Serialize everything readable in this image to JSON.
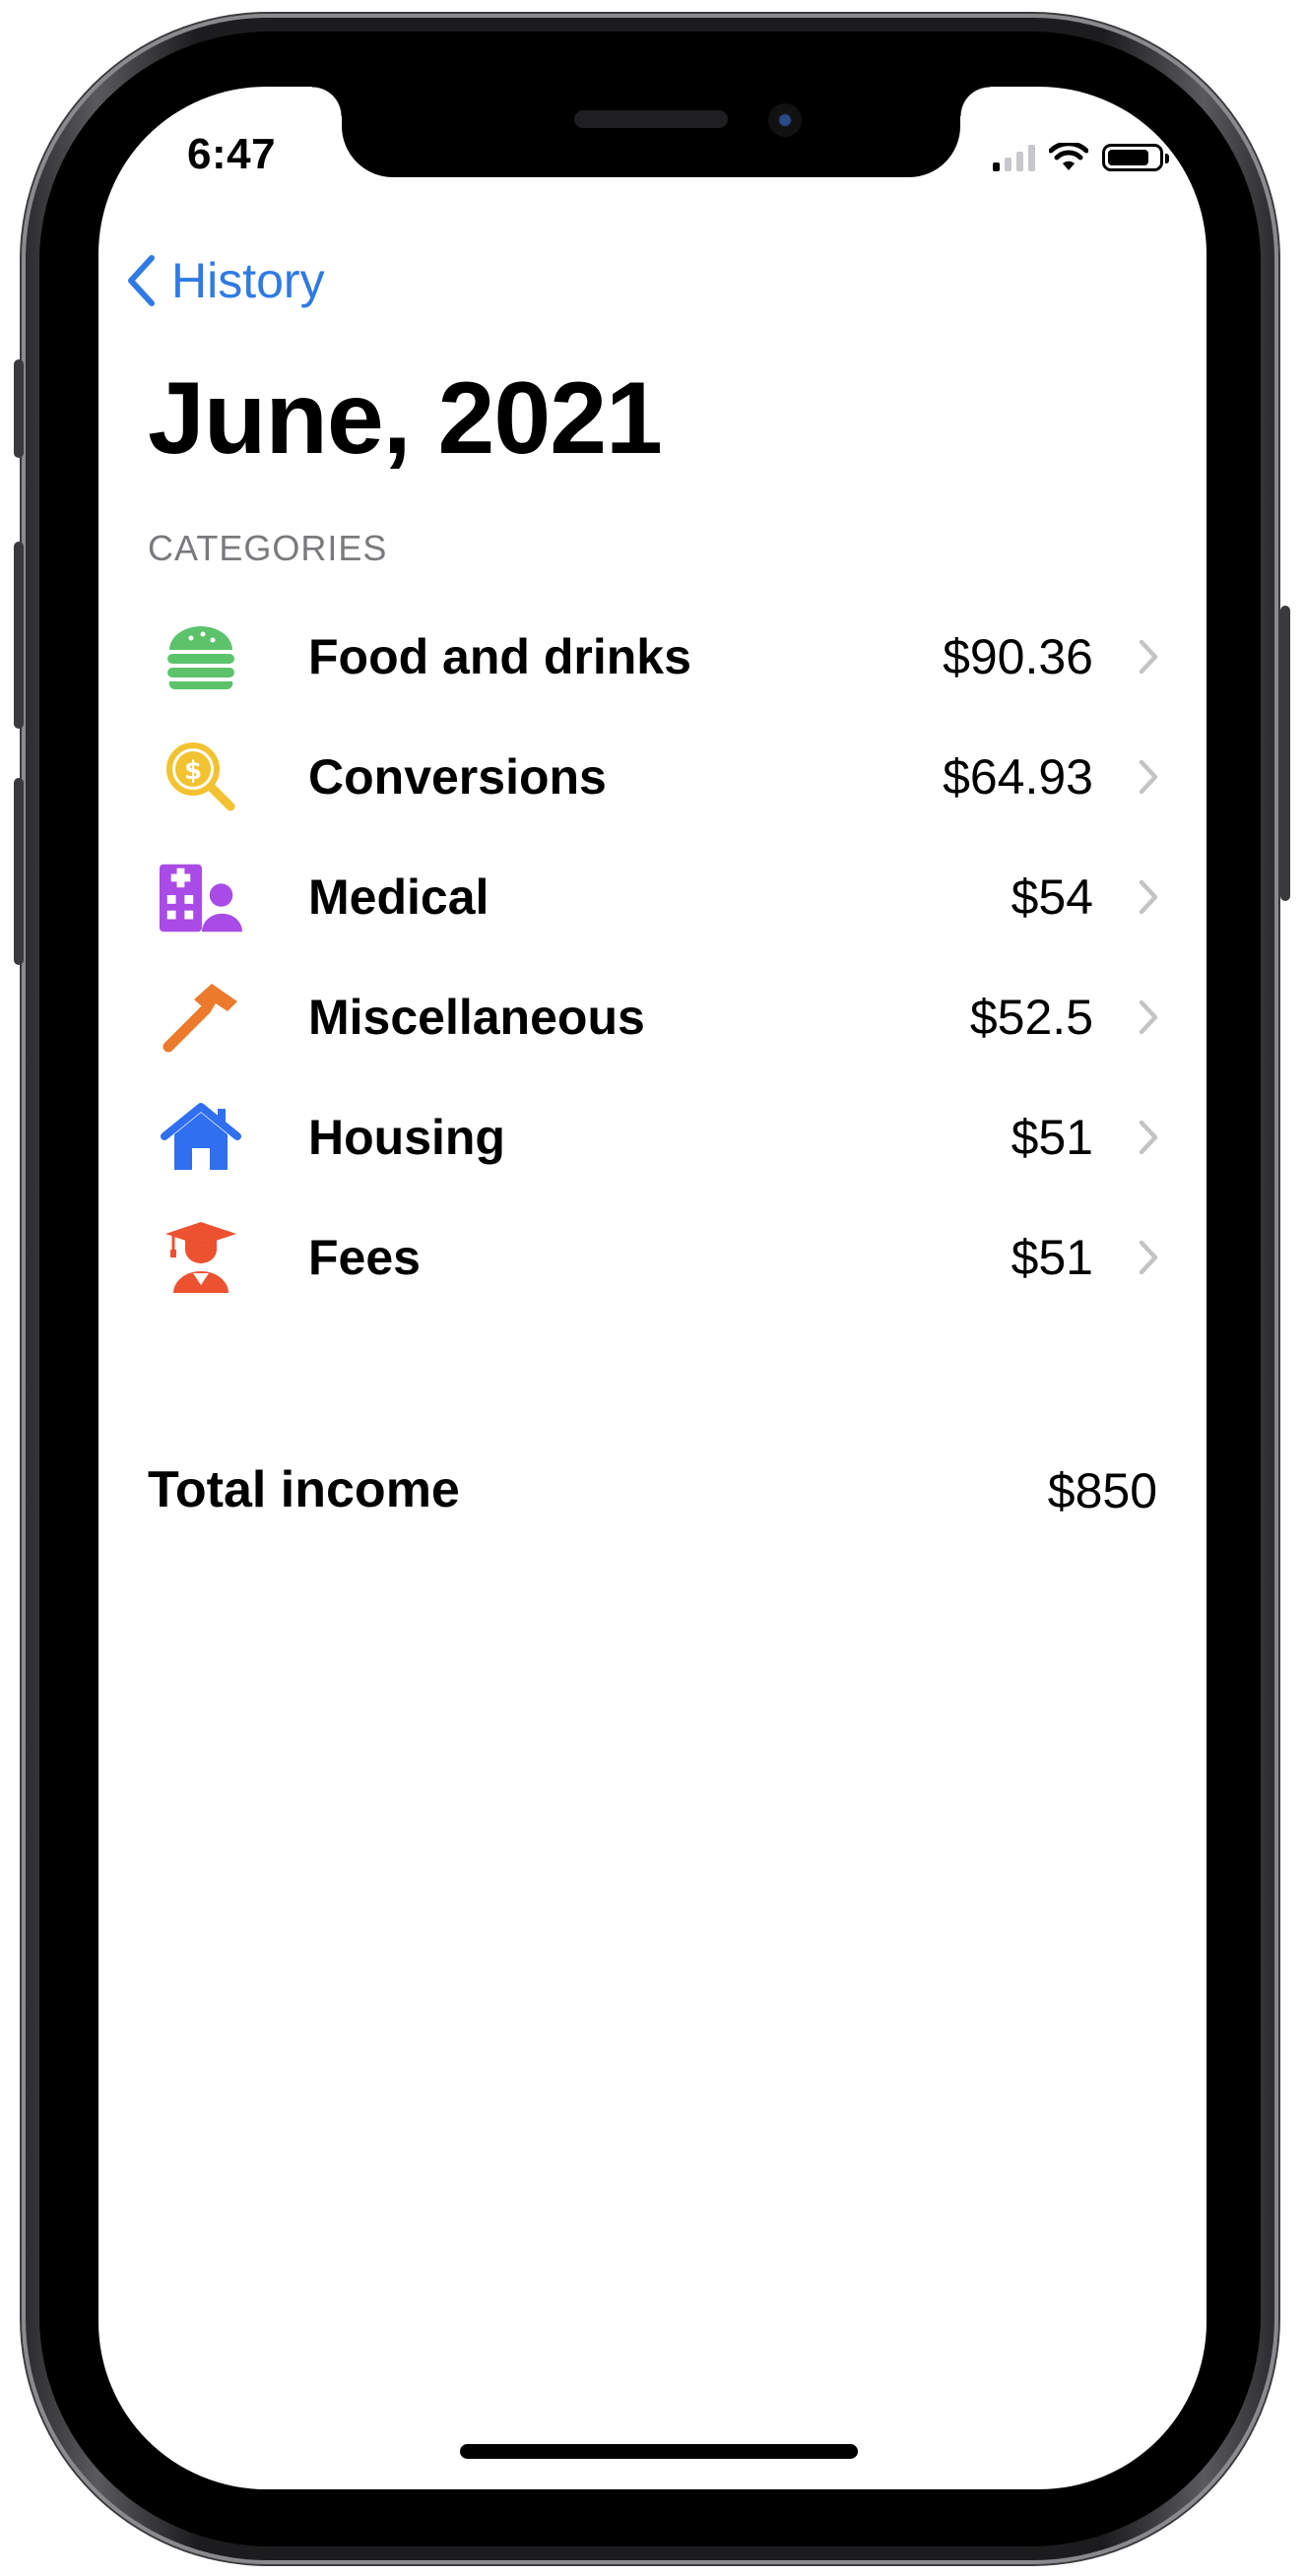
{
  "status_bar": {
    "time": "6:47",
    "icons": [
      "cellular-signal-icon",
      "wifi-icon",
      "battery-icon"
    ]
  },
  "nav": {
    "back_label": "History",
    "back_icon": "chevron-left-icon",
    "accent_color": "#2f7ae5"
  },
  "page": {
    "title": "June, 2021",
    "section_header": "CATEGORIES"
  },
  "categories": [
    {
      "label": "Food and drinks",
      "value": "$90.36",
      "icon": "burger-icon",
      "color": "#5cc36b"
    },
    {
      "label": "Conversions",
      "value": "$64.93",
      "icon": "magnifier-dollar-icon",
      "color": "#f2c230"
    },
    {
      "label": "Medical",
      "value": "$54",
      "icon": "hospital-person-icon",
      "color": "#a94be6"
    },
    {
      "label": "Miscellaneous",
      "value": "$52.5",
      "icon": "hammer-icon",
      "color": "#ec7a2c"
    },
    {
      "label": "Housing",
      "value": "$51",
      "icon": "house-icon",
      "color": "#2f6ff0"
    },
    {
      "label": "Fees",
      "value": "$51",
      "icon": "graduate-icon",
      "color": "#ec5130"
    }
  ],
  "total": {
    "label": "Total income",
    "value": "$850"
  }
}
